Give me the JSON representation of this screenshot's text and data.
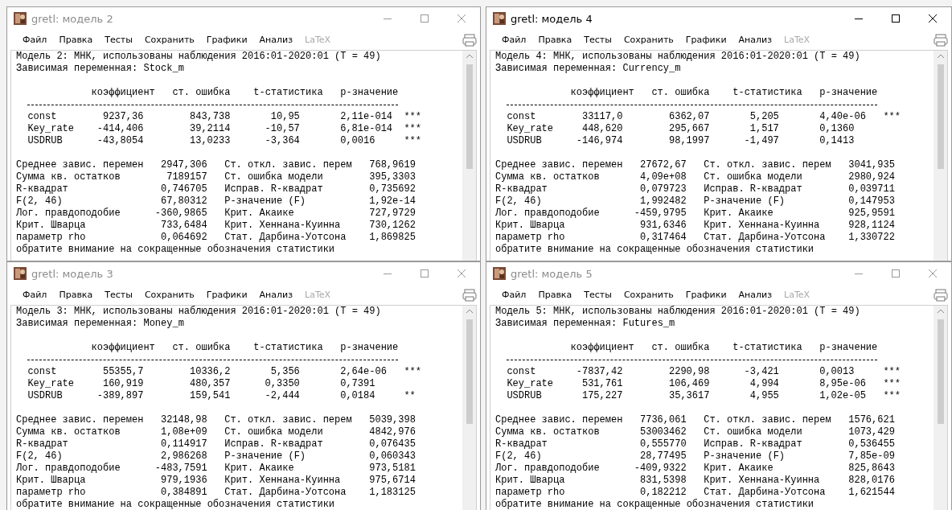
{
  "windows": [
    {
      "title": "gretl: модель 2",
      "active": false,
      "menu": [
        {
          "label": "Файл",
          "disabled": false
        },
        {
          "label": "Правка",
          "disabled": false
        },
        {
          "label": "Тесты",
          "disabled": false
        },
        {
          "label": "Сохранить",
          "disabled": false
        },
        {
          "label": "Графики",
          "disabled": false
        },
        {
          "label": "Анализ",
          "disabled": false
        },
        {
          "label": "LaTeX",
          "disabled": true
        }
      ],
      "model_line": "Модель 2: МНК, использованы наблюдения 2016:01-2020:01 (T = 49)",
      "dependent_line": "Зависимая переменная: Stock_m",
      "columns": [
        "коэффициент",
        "ст. ошибка",
        "t-статистика",
        "р-значение"
      ],
      "rows": [
        {
          "name": "const",
          "coef": "9237,36",
          "se": "843,738",
          "t": "10,95",
          "p": "2,11e-014",
          "signif": "***"
        },
        {
          "name": "Key_rate",
          "coef": "-414,406",
          "se": "39,2114",
          "t": "-10,57",
          "p": "6,81e-014",
          "signif": "***"
        },
        {
          "name": "USDRUB",
          "coef": "-43,8054",
          "se": "13,0233",
          "t": "-3,364",
          "p": "0,0016",
          "signif": "***"
        }
      ],
      "stats": [
        {
          "label1": "Среднее завис. перемен",
          "value1": "2947,306",
          "label2": "Ст. откл. завис. перем",
          "value2": "768,9619"
        },
        {
          "label1": "Сумма кв. остатков",
          "value1": "7189157",
          "label2": "Ст. ошибка модели",
          "value2": "395,3303"
        },
        {
          "label1": "R-квадрат",
          "value1": "0,746705",
          "label2": "Исправ. R-квадрат",
          "value2": "0,735692"
        },
        {
          "label1": "F(2, 46)",
          "value1": "67,80312",
          "label2": "Р-значение (F)",
          "value2": "1,92e-14"
        },
        {
          "label1": "Лог. правдоподобие",
          "value1": "-360,9865",
          "label2": "Крит. Акаике",
          "value2": "727,9729"
        },
        {
          "label1": "Крит. Шварца",
          "value1": "733,6484",
          "label2": "Крит. Хеннана-Куинна",
          "value2": "730,1262"
        },
        {
          "label1": "параметр rho",
          "value1": "0,064692",
          "label2": "Стат. Дарбина-Уотсона",
          "value2": "1,869825"
        }
      ],
      "footer": "обратите внимание на сокращенные обозначения статистики"
    },
    {
      "title": "gretl: модель 4",
      "active": true,
      "menu": [
        {
          "label": "Файл",
          "disabled": false
        },
        {
          "label": "Правка",
          "disabled": false
        },
        {
          "label": "Тесты",
          "disabled": false
        },
        {
          "label": "Сохранить",
          "disabled": false
        },
        {
          "label": "Графики",
          "disabled": false
        },
        {
          "label": "Анализ",
          "disabled": false
        },
        {
          "label": "LaTeX",
          "disabled": true
        }
      ],
      "model_line": "Модель 4: МНК, использованы наблюдения 2016:01-2020:01 (T = 49)",
      "dependent_line": "Зависимая переменная: Currency_m",
      "columns": [
        "коэффициент",
        "ст. ошибка",
        "t-статистика",
        "р-значение"
      ],
      "rows": [
        {
          "name": "const",
          "coef": "33117,0",
          "se": "6362,07",
          "t": "5,205",
          "p": "4,40e-06",
          "signif": "***"
        },
        {
          "name": "Key_rate",
          "coef": "448,620",
          "se": "295,667",
          "t": "1,517",
          "p": "0,1360"
        },
        {
          "name": "USDRUB",
          "coef": "-146,974",
          "se": "98,1997",
          "t": "-1,497",
          "p": "0,1413"
        }
      ],
      "stats": [
        {
          "label1": "Среднее завис. перемен",
          "value1": "27672,67",
          "label2": "Ст. откл. завис. перем",
          "value2": "3041,935"
        },
        {
          "label1": "Сумма кв. остатков",
          "value1": "4,09e+08",
          "label2": "Ст. ошибка модели",
          "value2": "2980,924"
        },
        {
          "label1": "R-квадрат",
          "value1": "0,079723",
          "label2": "Исправ. R-квадрат",
          "value2": "0,039711"
        },
        {
          "label1": "F(2, 46)",
          "value1": "1,992482",
          "label2": "Р-значение (F)",
          "value2": "0,147953"
        },
        {
          "label1": "Лог. правдоподобие",
          "value1": "-459,9795",
          "label2": "Крит. Акаике",
          "value2": "925,9591"
        },
        {
          "label1": "Крит. Шварца",
          "value1": "931,6346",
          "label2": "Крит. Хеннана-Куинна",
          "value2": "928,1124"
        },
        {
          "label1": "параметр rho",
          "value1": "0,317464",
          "label2": "Стат. Дарбина-Уотсона",
          "value2": "1,330722"
        }
      ],
      "footer": "обратите внимание на сокращенные обозначения статистики"
    },
    {
      "title": "gretl: модель 3",
      "active": false,
      "menu": [
        {
          "label": "Файл",
          "disabled": false
        },
        {
          "label": "Правка",
          "disabled": false
        },
        {
          "label": "Тесты",
          "disabled": false
        },
        {
          "label": "Сохранить",
          "disabled": false
        },
        {
          "label": "Графики",
          "disabled": false
        },
        {
          "label": "Анализ",
          "disabled": false
        },
        {
          "label": "LaTeX",
          "disabled": true
        }
      ],
      "model_line": "Модель 3: МНК, использованы наблюдения 2016:01-2020:01 (T = 49)",
      "dependent_line": "Зависимая переменная: Money_m",
      "columns": [
        "коэффициент",
        "ст. ошибка",
        "t-статистика",
        "р-значение"
      ],
      "rows": [
        {
          "name": "const",
          "coef": "55355,7",
          "se": "10336,2",
          "t": "5,356",
          "p": "2,64e-06",
          "signif": "***"
        },
        {
          "name": "Key_rate",
          "coef": "160,919",
          "se": "480,357",
          "t": "0,3350",
          "p": "0,7391"
        },
        {
          "name": "USDRUB",
          "coef": "-389,897",
          "se": "159,541",
          "t": "-2,444",
          "p": "0,0184",
          "signif": "**"
        }
      ],
      "stats": [
        {
          "label1": "Среднее завис. перемен",
          "value1": "32148,98",
          "label2": "Ст. откл. завис. перем",
          "value2": "5039,398"
        },
        {
          "label1": "Сумма кв. остатков",
          "value1": "1,08e+09",
          "label2": "Ст. ошибка модели",
          "value2": "4842,976"
        },
        {
          "label1": "R-квадрат",
          "value1": "0,114917",
          "label2": "Исправ. R-квадрат",
          "value2": "0,076435"
        },
        {
          "label1": "F(2, 46)",
          "value1": "2,986268",
          "label2": "Р-значение (F)",
          "value2": "0,060343"
        },
        {
          "label1": "Лог. правдоподобие",
          "value1": "-483,7591",
          "label2": "Крит. Акаике",
          "value2": "973,5181"
        },
        {
          "label1": "Крит. Шварца",
          "value1": "979,1936",
          "label2": "Крит. Хеннана-Куинна",
          "value2": "975,6714"
        },
        {
          "label1": "параметр rho",
          "value1": "0,384891",
          "label2": "Стат. Дарбина-Уотсона",
          "value2": "1,183125"
        }
      ],
      "footer": "обратите внимание на сокращенные обозначения статистики"
    },
    {
      "title": "gretl: модель 5",
      "active": false,
      "menu": [
        {
          "label": "Файл",
          "disabled": false
        },
        {
          "label": "Правка",
          "disabled": false
        },
        {
          "label": "Тесты",
          "disabled": false
        },
        {
          "label": "Сохранить",
          "disabled": false
        },
        {
          "label": "Графики",
          "disabled": false
        },
        {
          "label": "Анализ",
          "disabled": false
        },
        {
          "label": "LaTeX",
          "disabled": true
        }
      ],
      "model_line": "Модель 5: МНК, использованы наблюдения 2016:01-2020:01 (T = 49)",
      "dependent_line": "Зависимая переменная: Futures_m",
      "columns": [
        "коэффициент",
        "ст. ошибка",
        "t-статистика",
        "р-значение"
      ],
      "rows": [
        {
          "name": "const",
          "coef": "-7837,42",
          "se": "2290,98",
          "t": "-3,421",
          "p": "0,0013",
          "signif": "***"
        },
        {
          "name": "Key_rate",
          "coef": "531,761",
          "se": "106,469",
          "t": "4,994",
          "p": "8,95e-06",
          "signif": "***"
        },
        {
          "name": "USDRUB",
          "coef": "175,227",
          "se": "35,3617",
          "t": "4,955",
          "p": "1,02e-05",
          "signif": "***"
        }
      ],
      "stats": [
        {
          "label1": "Среднее завис. перемен",
          "value1": "7736,061",
          "label2": "Ст. откл. завис. перем",
          "value2": "1576,621"
        },
        {
          "label1": "Сумма кв. остатков",
          "value1": "53003462",
          "label2": "Ст. ошибка модели",
          "value2": "1073,429"
        },
        {
          "label1": "R-квадрат",
          "value1": "0,555770",
          "label2": "Исправ. R-квадрат",
          "value2": "0,536455"
        },
        {
          "label1": "F(2, 46)",
          "value1": "28,77495",
          "label2": "Р-значение (F)",
          "value2": "7,85e-09"
        },
        {
          "label1": "Лог. правдоподобие",
          "value1": "-409,9322",
          "label2": "Крит. Акаике",
          "value2": "825,8643"
        },
        {
          "label1": "Крит. Шварца",
          "value1": "831,5398",
          "label2": "Крит. Хеннана-Куинна",
          "value2": "828,0176"
        },
        {
          "label1": "параметр rho",
          "value1": "0,182212",
          "label2": "Стат. Дарбина-Уотсона",
          "value2": "1,621544"
        }
      ],
      "footer": "обратите внимание на сокращенные обозначения статистики"
    }
  ]
}
